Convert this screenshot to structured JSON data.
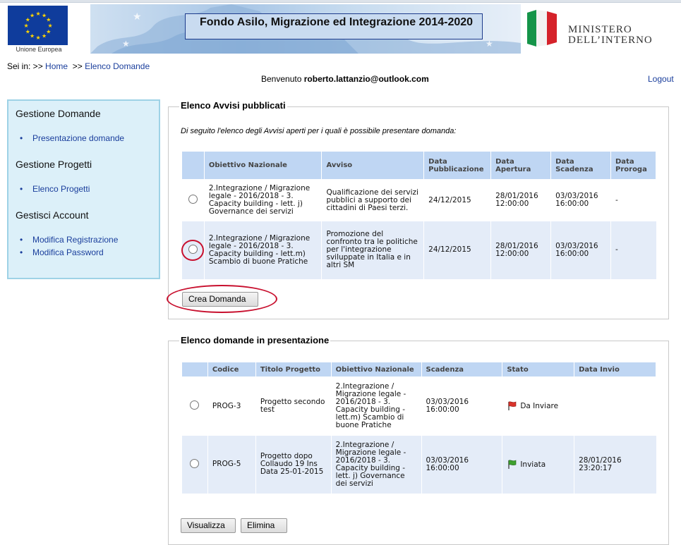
{
  "header": {
    "eu_label": "Unione Europea",
    "title": "Fondo Asilo, Migrazione ed Integrazione 2014-2020",
    "ministry_line1": "MINISTERO",
    "ministry_line2": "DELL’INTERNO"
  },
  "breadcrumb": {
    "prefix": "Sei in: >>",
    "home": "Home",
    "sep": ">>",
    "current": "Elenco Domande"
  },
  "welcome": {
    "label": "Benvenuto",
    "user": "roberto.lattanzio@outlook.com"
  },
  "logout": "Logout",
  "sidebar": {
    "sections": [
      {
        "title": "Gestione Domande",
        "items": [
          "Presentazione domande"
        ]
      },
      {
        "title": "Gestione Progetti",
        "items": [
          "Elenco Progetti"
        ]
      },
      {
        "title": "Gestisci Account",
        "items": [
          "Modifica Registrazione",
          "Modifica Password"
        ]
      }
    ]
  },
  "avvisi": {
    "legend": "Elenco Avvisi pubblicati",
    "intro": "Di seguito l'elenco degli Avvisi aperti per i quali è possibile presentare domanda:",
    "columns": [
      "Obiettivo Nazionale",
      "Avviso",
      "Data Pubblicazione",
      "Data Apertura",
      "Data Scadenza",
      "Data Proroga"
    ],
    "rows": [
      {
        "obiettivo": "2.Integrazione / Migrazione legale - 2016/2018 - 3. Capacity building - lett. j) Governance dei servizi",
        "avviso": "Qualificazione dei servizi pubblici a supporto dei cittadini di Paesi terzi.",
        "pubblicazione": "24/12/2015",
        "apertura": "28/01/2016 12:00:00",
        "scadenza": "03/03/2016 16:00:00",
        "proroga": "-"
      },
      {
        "obiettivo": "2.Integrazione / Migrazione legale - 2016/2018 - 3. Capacity building - lett.m) Scambio di buone Pratiche",
        "avviso": "Promozione del confronto tra le politiche per l'integrazione sviluppate in Italia e in altri SM",
        "pubblicazione": "24/12/2015",
        "apertura": "28/01/2016 12:00:00",
        "scadenza": "03/03/2016 16:00:00",
        "proroga": "-"
      }
    ],
    "button": "Crea Domanda"
  },
  "domande": {
    "legend": "Elenco domande in presentazione",
    "columns": [
      "Codice",
      "Titolo Progetto",
      "Obiettivo Nazionale",
      "Scadenza",
      "Stato",
      "Data Invio"
    ],
    "rows": [
      {
        "codice": "PROG-3",
        "titolo": "Progetto secondo test",
        "obiettivo": "2.Integrazione / Migrazione legale - 2016/2018 - 3. Capacity building - lett.m) Scambio di buone Pratiche",
        "scadenza": "03/03/2016 16:00:00",
        "stato": "Da Inviare",
        "stato_icon": "red-flag-icon",
        "stato_color": "#d9332b",
        "data_invio": ""
      },
      {
        "codice": "PROG-5",
        "titolo": "Progetto dopo Collaudo 19 Ins Data 25-01-2015",
        "obiettivo": "2.Integrazione / Migrazione legale - 2016/2018 - 3. Capacity building - lett. j) Governance dei servizi",
        "scadenza": "03/03/2016 16:00:00",
        "stato": "Inviata",
        "stato_icon": "green-flag-icon",
        "stato_color": "#3ea12f",
        "data_invio": "28/01/2016 23:20:17"
      }
    ],
    "buttons": [
      "Visualizza",
      "Elimina"
    ]
  }
}
